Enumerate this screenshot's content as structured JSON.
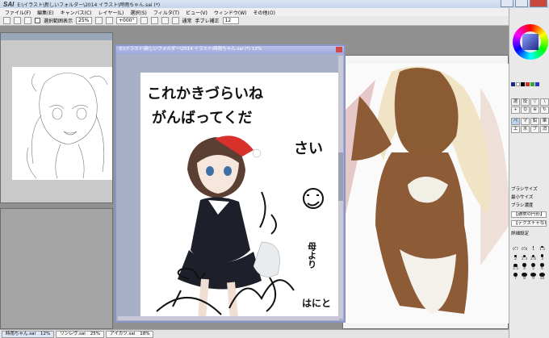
{
  "app": {
    "logo": "SAI",
    "path": "E:\\イラスト\\新しいフォルダー\\2014 イラスト\\時雨ちゃん.sai (*)"
  },
  "menu": [
    "ファイル(F)",
    "編集(E)",
    "キャンバス(C)",
    "レイヤー(L)",
    "選択(S)",
    "フィルタ(T)",
    "ビュー(V)",
    "ウィンドウ(W)",
    "その他(O)"
  ],
  "toolbar": {
    "selection_label": "選択範囲表示",
    "zoom": "25%",
    "rotation": "+000°",
    "normal_label": "通常",
    "stabilizer_label": "手ブレ補正",
    "stabilizer_value": "12"
  },
  "documents": {
    "main_title": "E:\\イラスト\\新しいフォルダー\\2014 イラスト\\時雨ちゃん.sai (*) 12%"
  },
  "drawing_text": {
    "line1": "これかきづらいね",
    "line2": "がんばってくだ",
    "line3": "さい",
    "mother": "母より",
    "signature": "はにと"
  },
  "status_tabs": [
    {
      "name": "時雨ちゃん.sai",
      "zoom": "12%"
    },
    {
      "name": "リンレヴ.sai",
      "zoom": "25%"
    },
    {
      "name": "アイカツ.sai",
      "zoom": "18%"
    }
  ],
  "panel": {
    "brush_size_label": "ブラシサイズ",
    "min_size_label": "最小サイズ",
    "density_label": "ブラシ濃度",
    "normal_circle": "【通常の円形】",
    "texture": "【テクスチャなし】",
    "detail_label": "詳細設定",
    "tools": [
      "選",
      "投",
      "▽",
      "\\",
      "+",
      "Q",
      "⊕",
      "↻",
      "ペ",
      "マ",
      "鉛",
      "筆",
      "エ",
      "水",
      "ブ",
      "消"
    ],
    "sizes": [
      "0.7",
      "0.8",
      "1",
      "1.5",
      "2",
      "2.3",
      "2.6",
      "3",
      "3.5",
      "4",
      "5",
      "6",
      "7",
      "8",
      "9",
      "10"
    ]
  },
  "colors": {
    "main_frame": "#8c95c8",
    "primary": "#1e2a8a"
  }
}
